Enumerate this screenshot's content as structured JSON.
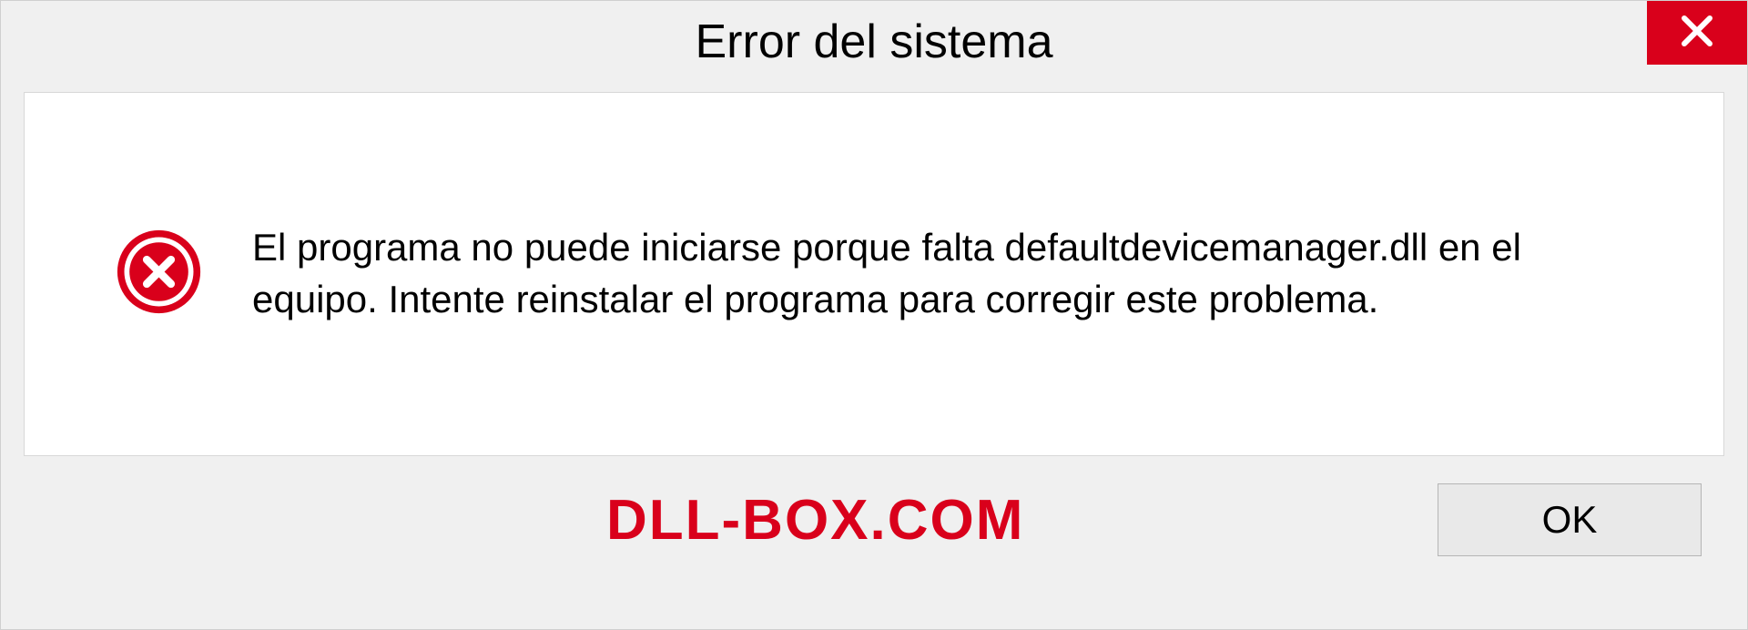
{
  "dialog": {
    "title": "Error del sistema",
    "message": "El programa no puede iniciarse porque falta defaultdevicemanager.dll en el equipo. Intente reinstalar el programa para corregir este problema.",
    "ok_label": "OK"
  },
  "watermark": "DLL-BOX.COM",
  "colors": {
    "error_red": "#d9001b",
    "background": "#f0f0f0",
    "content_bg": "#ffffff"
  }
}
